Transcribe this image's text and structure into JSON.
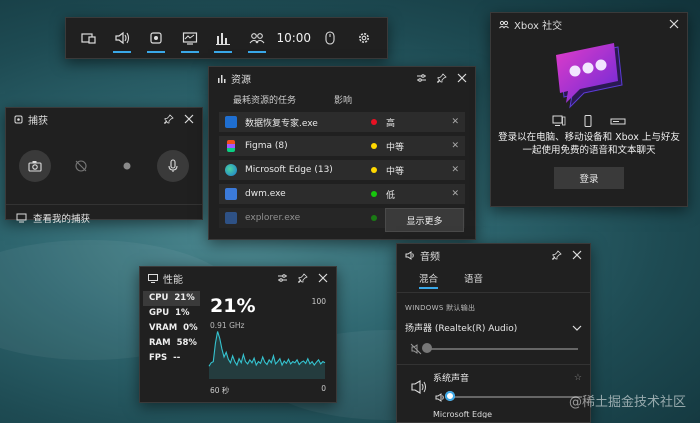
{
  "topbar": {
    "time": "10:00",
    "icons": [
      "widget-menu-icon",
      "audio-icon",
      "capture-icon",
      "performance-icon",
      "resources-icon",
      "xbox-social-icon",
      "mouse-icon",
      "settings-icon"
    ]
  },
  "capture": {
    "title": "捕获",
    "link": "查看我的捕获"
  },
  "resources": {
    "title": "资源",
    "col_task": "最耗资源的任务",
    "col_impact": "影响",
    "rows": [
      {
        "name": "数据恢复专家.exe",
        "impact": "高",
        "color": "#e81123"
      },
      {
        "name": "Figma (8)",
        "impact": "中等",
        "color": "#ffd800"
      },
      {
        "name": "Microsoft Edge (13)",
        "impact": "中等",
        "color": "#ffd800"
      },
      {
        "name": "dwm.exe",
        "impact": "低",
        "color": "#16c60c"
      },
      {
        "name": "explorer.exe",
        "impact": "低",
        "color": "#16c60c"
      }
    ],
    "show_more": "显示更多"
  },
  "xbox": {
    "title": "Xbox 社交",
    "message": "登录以在电脑、移动设备和 Xbox 上与好友一起使用免费的语音和文本聊天",
    "login": "登录"
  },
  "performance": {
    "title": "性能",
    "metrics": [
      {
        "label": "CPU",
        "value": "21%"
      },
      {
        "label": "GPU",
        "value": "1%"
      },
      {
        "label": "VRAM",
        "value": "0%"
      },
      {
        "label": "RAM",
        "value": "58%"
      },
      {
        "label": "FPS",
        "value": "--"
      }
    ],
    "big": "21%",
    "freq": "0.91 GHz",
    "ymax": "100",
    "ymin": "0",
    "xlabel": "60 秒"
  },
  "chart_data": {
    "type": "line",
    "ylim": [
      0,
      100
    ],
    "values": [
      22,
      28,
      30,
      62,
      82,
      70,
      52,
      38,
      46,
      34,
      28,
      40,
      30,
      24,
      35,
      28,
      42,
      30,
      26,
      33,
      28,
      36,
      24,
      30,
      27,
      38,
      29,
      25,
      33,
      28,
      40,
      26,
      30,
      35,
      24,
      31,
      27,
      34,
      26,
      30,
      28,
      33,
      25,
      29,
      31,
      27,
      35,
      26,
      30,
      24,
      29,
      33,
      26,
      30,
      28
    ]
  },
  "audio": {
    "title": "音频",
    "tab_mix": "混合",
    "tab_voice": "语音",
    "section": "WINDOWS 默认输出",
    "device": "扬声器 (Realtek(R) Audio)",
    "master_level": 0.0,
    "system_sound": "系统声音",
    "system_level": 0.02,
    "next_item": "Microsoft Edge"
  },
  "watermark": "@稀土掘金技术社区"
}
